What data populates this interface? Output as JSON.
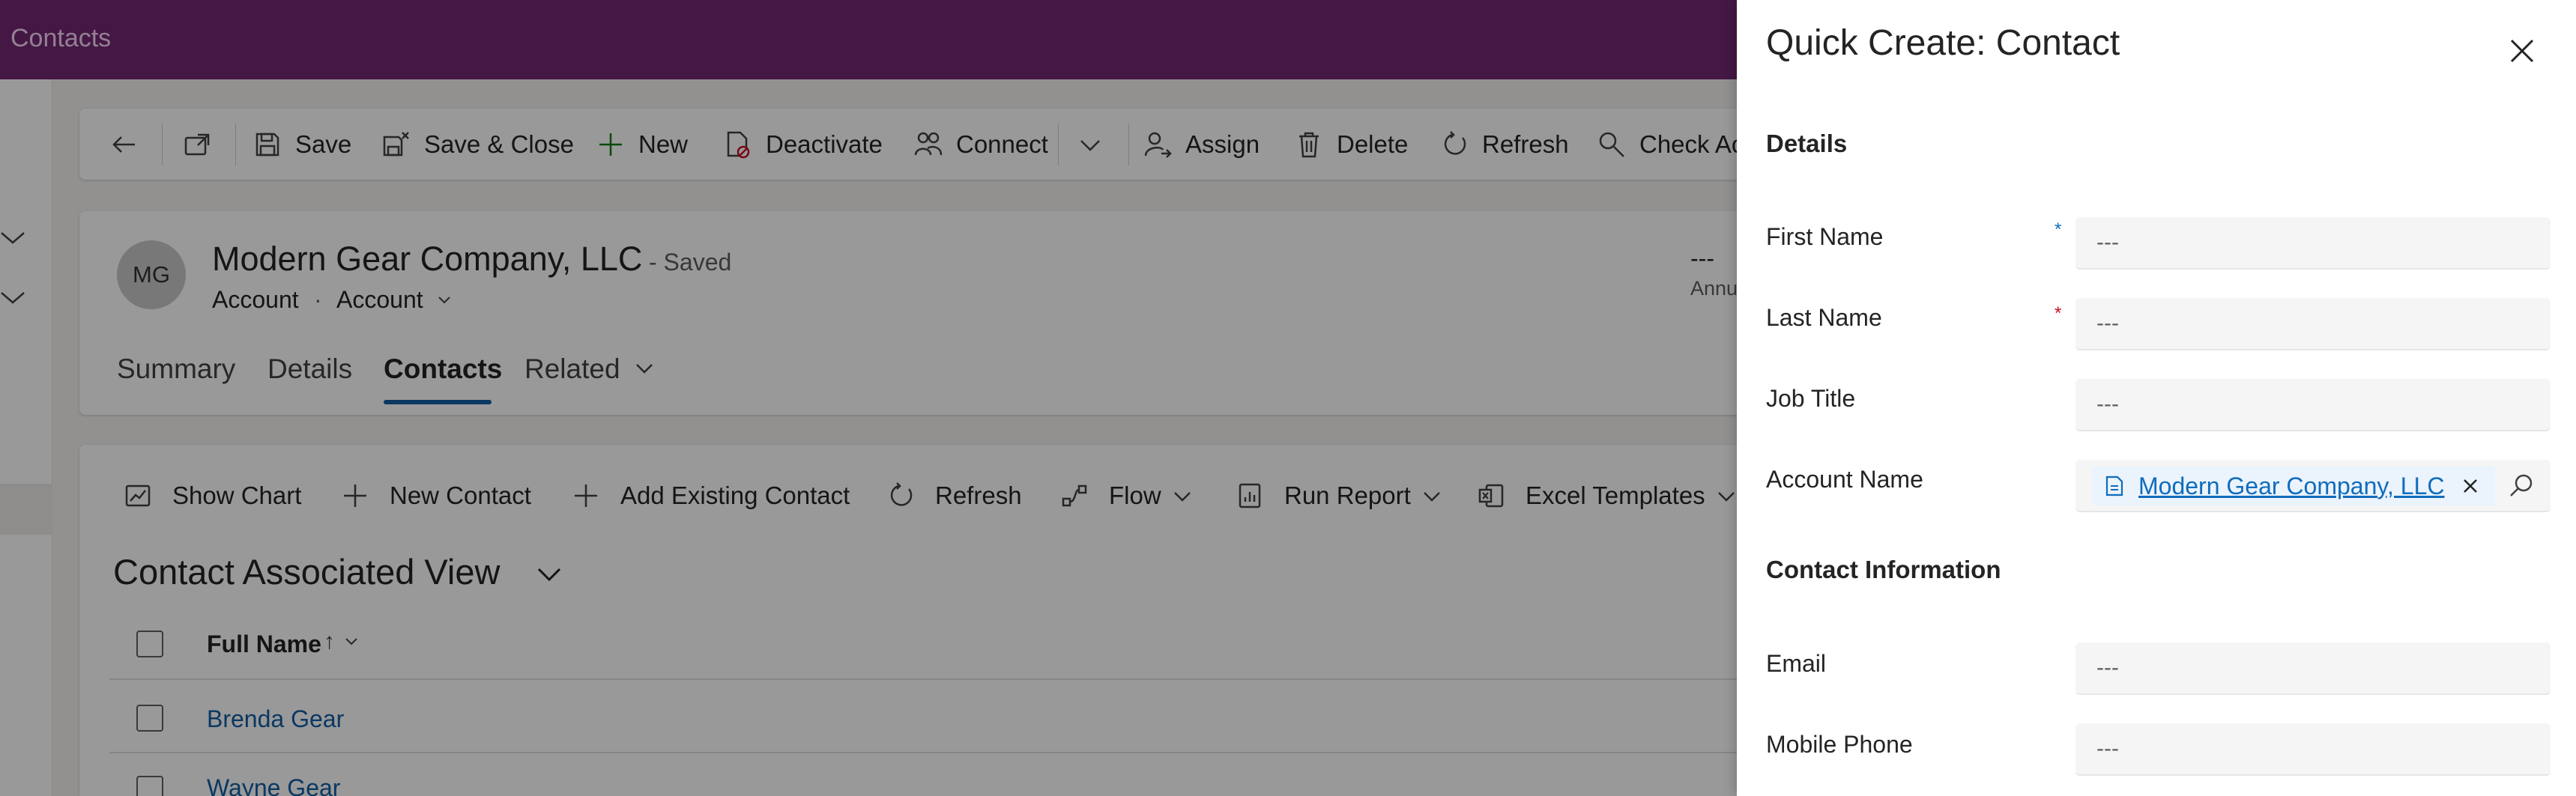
{
  "app": {
    "area_title": "Contacts"
  },
  "command_bar": {
    "save": "Save",
    "save_close": "Save & Close",
    "new": "New",
    "deactivate": "Deactivate",
    "connect": "Connect",
    "assign": "Assign",
    "delete": "Delete",
    "refresh": "Refresh",
    "check_access": "Check Acc"
  },
  "record": {
    "initials": "MG",
    "name": "Modern Gear Company, LLC",
    "saved_status": "- Saved",
    "entity": "Account",
    "separator": "·",
    "form": "Account",
    "header_value": "---",
    "header_field": "Annu"
  },
  "tabs": [
    {
      "label": "Summary"
    },
    {
      "label": "Details"
    },
    {
      "label": "Contacts"
    },
    {
      "label": "Related"
    }
  ],
  "subgrid": {
    "commands": {
      "show_chart": "Show Chart",
      "new_contact": "New Contact",
      "add_existing": "Add Existing Contact",
      "refresh": "Refresh",
      "flow": "Flow",
      "run_report": "Run Report",
      "excel_templates": "Excel Templates"
    },
    "view_title": "Contact Associated View",
    "column_header": "Full Name",
    "sort_indicator": "↑",
    "rows": [
      {
        "full_name": "Brenda Gear"
      },
      {
        "full_name": "Wayne Gear"
      }
    ]
  },
  "quick_create": {
    "title": "Quick Create: Contact",
    "sections": {
      "details": "Details",
      "contact_info": "Contact Information"
    },
    "fields": {
      "first_name": {
        "label": "First Name",
        "value": "---",
        "required_mark": "*"
      },
      "last_name": {
        "label": "Last Name",
        "value": "---",
        "required_mark": "*"
      },
      "job_title": {
        "label": "Job Title",
        "value": "---"
      },
      "account_name": {
        "label": "Account Name",
        "value": "Modern Gear Company, LLC"
      },
      "email": {
        "label": "Email",
        "value": "---"
      },
      "mobile_phone": {
        "label": "Mobile Phone",
        "value": "---"
      }
    }
  },
  "colors": {
    "brand_bar": "#742774",
    "active_tab_underline": "#115ea3",
    "link": "#0f6cbd",
    "required_business": "#0f6cbd",
    "required": "#c50f1f"
  },
  "icons": [
    "back-icon",
    "open-window-icon",
    "save-icon",
    "save-close-icon",
    "plus-icon",
    "deactivate-icon",
    "connect-icon",
    "chevron-down-icon",
    "assign-icon",
    "delete-icon",
    "refresh-icon",
    "check-access-icon",
    "chart-icon",
    "flow-icon",
    "report-icon",
    "excel-icon",
    "close-icon",
    "record-icon",
    "search-icon"
  ]
}
